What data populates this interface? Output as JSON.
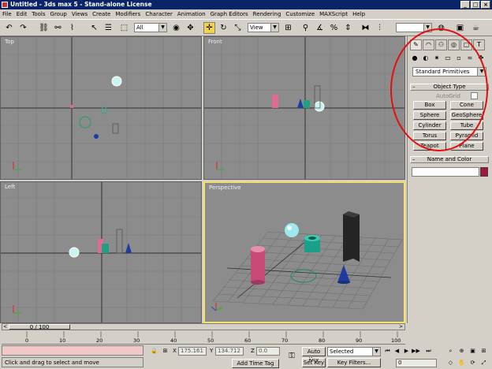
{
  "window": {
    "title": "Untitled - 3ds max 5 - Stand-alone License"
  },
  "menu": [
    "File",
    "Edit",
    "Tools",
    "Group",
    "Views",
    "Create",
    "Modifiers",
    "Character",
    "Animation",
    "Graph Editors",
    "Rendering",
    "Customize",
    "MAXScript",
    "Help"
  ],
  "toolbar": {
    "selection_filter": "All",
    "ref_coord": "View"
  },
  "viewports": {
    "top": "Top",
    "front": "Front",
    "left": "Left",
    "perspective": "Perspective"
  },
  "command_panel": {
    "dropdown": "Standard Primitives",
    "object_type_title": "Object Type",
    "autogrid_label": "AutoGrid",
    "buttons": [
      "Box",
      "Cone",
      "Sphere",
      "GeoSphere",
      "Cylinder",
      "Tube",
      "Torus",
      "Pyramid",
      "Teapot",
      "Plane"
    ],
    "name_color_title": "Name and Color",
    "object_color": "#a01840"
  },
  "timeline": {
    "frame_indicator": "0 / 100",
    "ticks": [
      "0",
      "10",
      "20",
      "30",
      "40",
      "50",
      "60",
      "70",
      "80",
      "90",
      "100"
    ]
  },
  "status": {
    "prompt": "Click and drag to select and move",
    "add_time_tag": "Add Time Tag",
    "x_label": "X",
    "x": "175.161",
    "y_label": "Y",
    "y": "134.712",
    "z_label": "Z",
    "z": "0.0",
    "auto_key": "Auto Key",
    "set_key": "Set Key",
    "key_mode": "Selected",
    "key_filters": "Key Filters...",
    "current_frame": "0"
  },
  "colors": {
    "highlight": "#e01010",
    "active_viewport": "#f5e06a",
    "viewport_bg": "#8c8c8c"
  }
}
